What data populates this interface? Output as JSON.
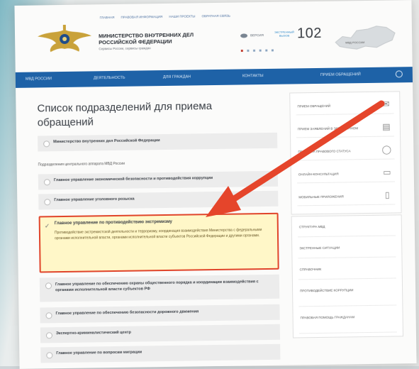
{
  "header": {
    "top_links": [
      "ГЛАВНАЯ",
      "ПРАВОВАЯ ИНФОРМАЦИЯ",
      "НАШИ ПРОЕКТЫ",
      "ОБРАТНАЯ СВЯЗЬ"
    ],
    "org_name_line1": "МИНИСТЕРСТВО ВНУТРЕННИХ ДЕЛ",
    "org_name_line2": "РОССИЙСКОЙ ФЕДЕРАЦИИ",
    "org_sub": "Сервисы России, сервисы граждан",
    "eye_label": "ВЕРСИЯ",
    "sos_label_1": "ЭКСТРЕННЫЙ",
    "sos_label_2": "ВЫЗОВ",
    "phone": "102",
    "map_label": "МВД РОССИИ"
  },
  "navbar": {
    "items": [
      "МВД РОССИИ",
      "ДЕЯТЕЛЬНОСТЬ",
      "ДЛЯ ГРАЖДАН",
      "КОНТАКТЫ",
      "ПРИЕМ ОБРАЩЕНИЙ"
    ]
  },
  "main": {
    "title": "Список подразделений для приема обращений",
    "row_top": "Министерство внутренних дел Российской Федерации",
    "subhead": "Подразделения центрального аппарата МВД России",
    "rows_a": [
      "Главное управление экономической безопасности и противодействия коррупции",
      "Главное управление уголовного розыска"
    ],
    "highlight": {
      "title": "Главное управление по противодействию экстремизму",
      "description": "Противодействие экстремистской деятельности и терроризму, координация взаимодействия Министерства с федеральными органами исполнительной власти, органами исполнительной власти субъектов Российской Федерации и другими органами."
    },
    "rows_b": [
      "Главное управление по обеспечению охраны общественного порядка и координации взаимодействия с органами исполнительной власти субъектов РФ",
      "Главное управление по обеспечению безопасности дорожного движения",
      "Экспертно-криминалистический центр",
      "Главное управление по вопросам миграции"
    ]
  },
  "sidebar": {
    "box1": [
      {
        "label": "ПРИЕМ ОБРАЩЕНИЙ",
        "icon": "envelope-icon"
      },
      {
        "label": "ПРИЕМ ЗАЯВЛЕНИЙ В ЭЛЕКТРОННОМ",
        "icon": "document-icon"
      },
      {
        "label": "ПРОВЕРКА ПРАВОВОГО СТАТУСА",
        "icon": "shield-icon"
      },
      {
        "label": "ОНЛАЙН-КОНСУЛЬТАЦИЯ",
        "icon": "chat-icon"
      },
      {
        "label": "МОБИЛЬНЫЕ ПРИЛОЖЕНИЯ",
        "icon": "phone-icon"
      }
    ],
    "box2": [
      "СТРУКТУРА МВД",
      "ЭКСТРЕННЫЕ СИТУАЦИИ",
      "СПРАВОЧНИК",
      "ПРОТИВОДЕЙСТВИЕ КОРРУПЦИИ",
      "ПРАВОВАЯ ПОМОЩЬ ГРАЖДАНАМ"
    ]
  },
  "colors": {
    "navbar": "#1e62a7",
    "highlight_border": "#e0442a",
    "arrow": "#e5452b"
  }
}
